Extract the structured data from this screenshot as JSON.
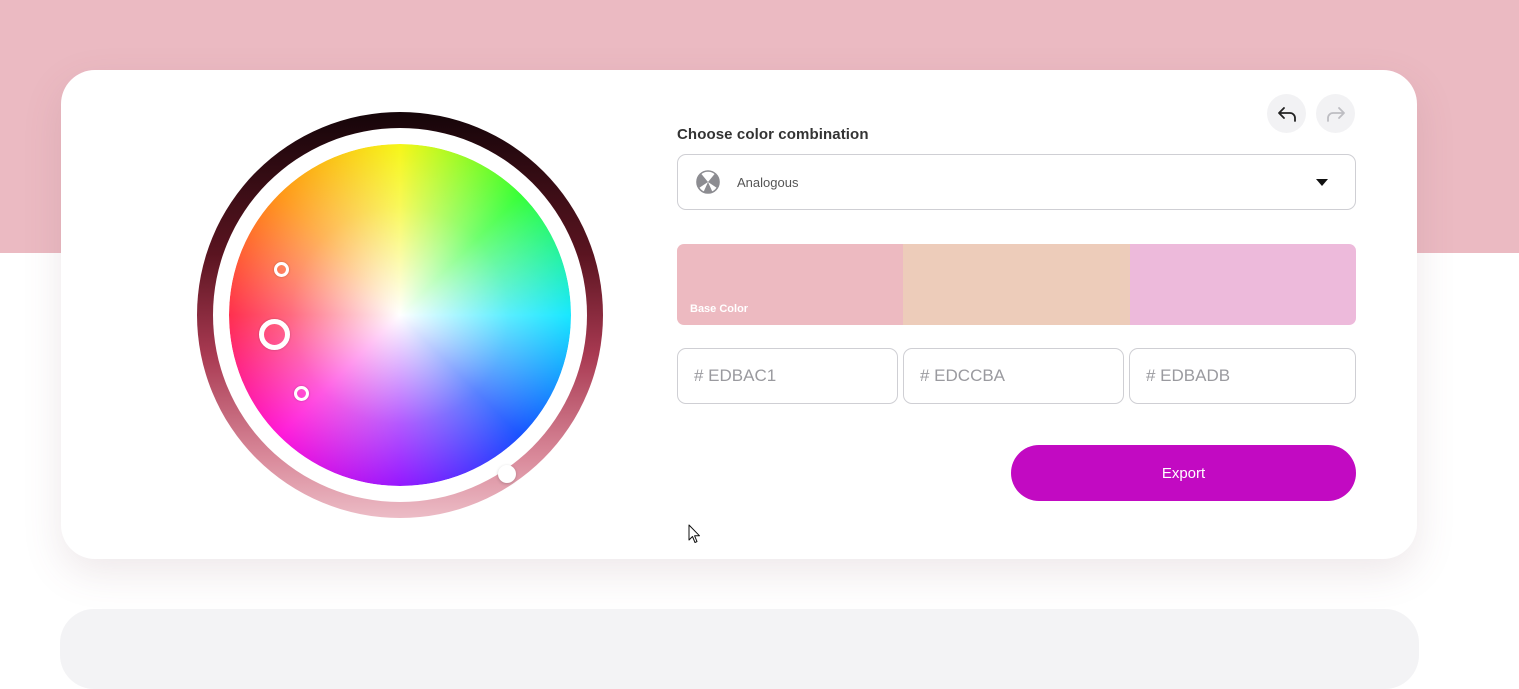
{
  "colors": {
    "page_band": "#ebbac2",
    "accent": "#c20ac2"
  },
  "history": {
    "undo_icon": "undo-arrow-icon",
    "redo_icon": "redo-arrow-icon"
  },
  "combination": {
    "label": "Choose color combination",
    "selected": "Analogous",
    "icon": "analogous-scheme-icon"
  },
  "palette": {
    "swatches": [
      {
        "label": "Base Color",
        "color": "#EDBAC1"
      },
      {
        "label": "",
        "color": "#EDCCBA"
      },
      {
        "label": "",
        "color": "#EDBADB"
      }
    ],
    "hex_values": [
      "# EDBAC1",
      "# EDCCBA",
      "# EDBADB"
    ]
  },
  "export": {
    "label": "Export"
  }
}
